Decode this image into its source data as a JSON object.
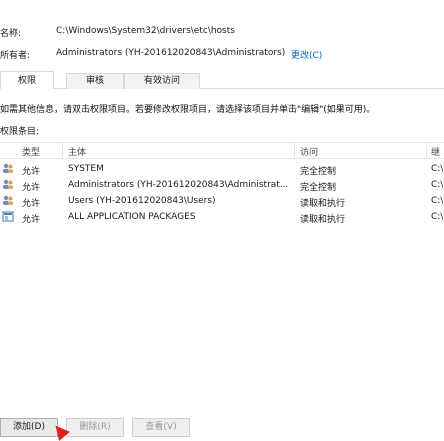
{
  "name_label": "名称:",
  "name_value": "C:\\Windows\\System32\\drivers\\etc\\hosts",
  "owner_label": "所有者:",
  "owner_value": "Administrators (YH-201612020843\\Administrators)",
  "change_link": "更改(C)",
  "tabs": [
    {
      "label": "权限"
    },
    {
      "label": "审核"
    },
    {
      "label": "有效访问"
    }
  ],
  "hint": "如需其他信息，请双击权限项目。若要修改权限项目，请选择该项目并单击\"编辑\"(如果可用)。",
  "list_title": "权限条目:",
  "table": {
    "headers": [
      "类型",
      "主体",
      "访问",
      "继"
    ],
    "rows": [
      {
        "type": "允许",
        "principal": "SYSTEM",
        "access": "完全控制",
        "inherit": "C:\\"
      },
      {
        "type": "允许",
        "principal": "Administrators (YH-201612020843\\Administrat...",
        "access": "完全控制",
        "inherit": "C:\\"
      },
      {
        "type": "允许",
        "principal": "Users (YH-201612020843\\Users)",
        "access": "读取和执行",
        "inherit": "C:\\"
      },
      {
        "type": "允许",
        "principal": "ALL APPLICATION PACKAGES",
        "access": "读取和执行",
        "inherit": "C:\\"
      }
    ]
  },
  "buttons": {
    "add": "添加(D)",
    "remove": "删除(R)",
    "view": "查看(V)"
  }
}
